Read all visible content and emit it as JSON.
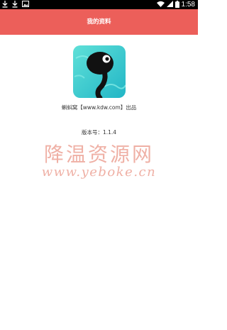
{
  "status_bar": {
    "time": "1:58",
    "left_icons": [
      "download-icon",
      "download-icon",
      "image-icon"
    ],
    "right_icons": [
      "wifi-icon",
      "signal-icon",
      "battery-icon"
    ]
  },
  "app_bar": {
    "title": "我的资料",
    "color": "#ec5f5a"
  },
  "about": {
    "logo_icon": "tadpole-app-icon",
    "credit": "蝌蚪窝【www.kdw.com】出品",
    "version": "版本号：1.1.4"
  },
  "watermark": {
    "title": "降温资源网",
    "url": "www.yeboke.cn"
  }
}
